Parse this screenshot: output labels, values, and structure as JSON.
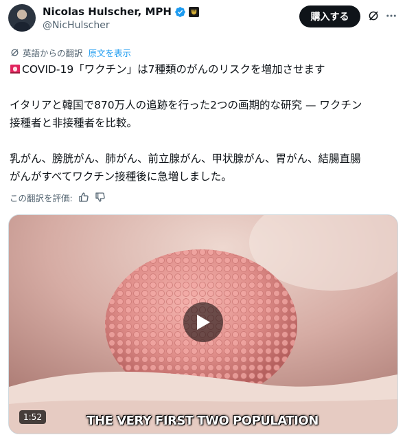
{
  "author": {
    "name": "Nicolas Hulscher, MPH",
    "handle": "@NicHulscher"
  },
  "header": {
    "buy_label": "購入する"
  },
  "translation": {
    "notice": "英語からの翻訳",
    "show_original": "原文を表示",
    "rate_label": "この翻訳を評価:"
  },
  "tweet": {
    "line1": "COVID-19「ワクチン」は7種類のがんのリスクを増加させます",
    "line2": "イタリアと韓国で870万人の追跡を行った2つの画期的な研究 — ワクチン\n接種者と非接種者を比較。",
    "line3": "乳がん、膀胱がん、肺がん、前立腺がん、甲状腺がん、胃がん、結腸直腸\nがんがすべてワクチン接種後に急増しました。"
  },
  "media": {
    "duration": "1:52",
    "caption": "THE VERY FIRST TWO POPULATION"
  },
  "colors": {
    "accent": "#1d9bf0",
    "text": "#0f1419",
    "muted": "#536471"
  },
  "icons": {
    "verified": "verified-badge-icon",
    "affiliation": "affiliation-badge-icon",
    "grok": "grok-icon",
    "more": "more-options-icon",
    "translate": "translate-icon",
    "siren": "siren-emoji-icon",
    "thumbs_up": "thumbs-up-icon",
    "thumbs_down": "thumbs-down-icon",
    "play": "play-icon"
  }
}
